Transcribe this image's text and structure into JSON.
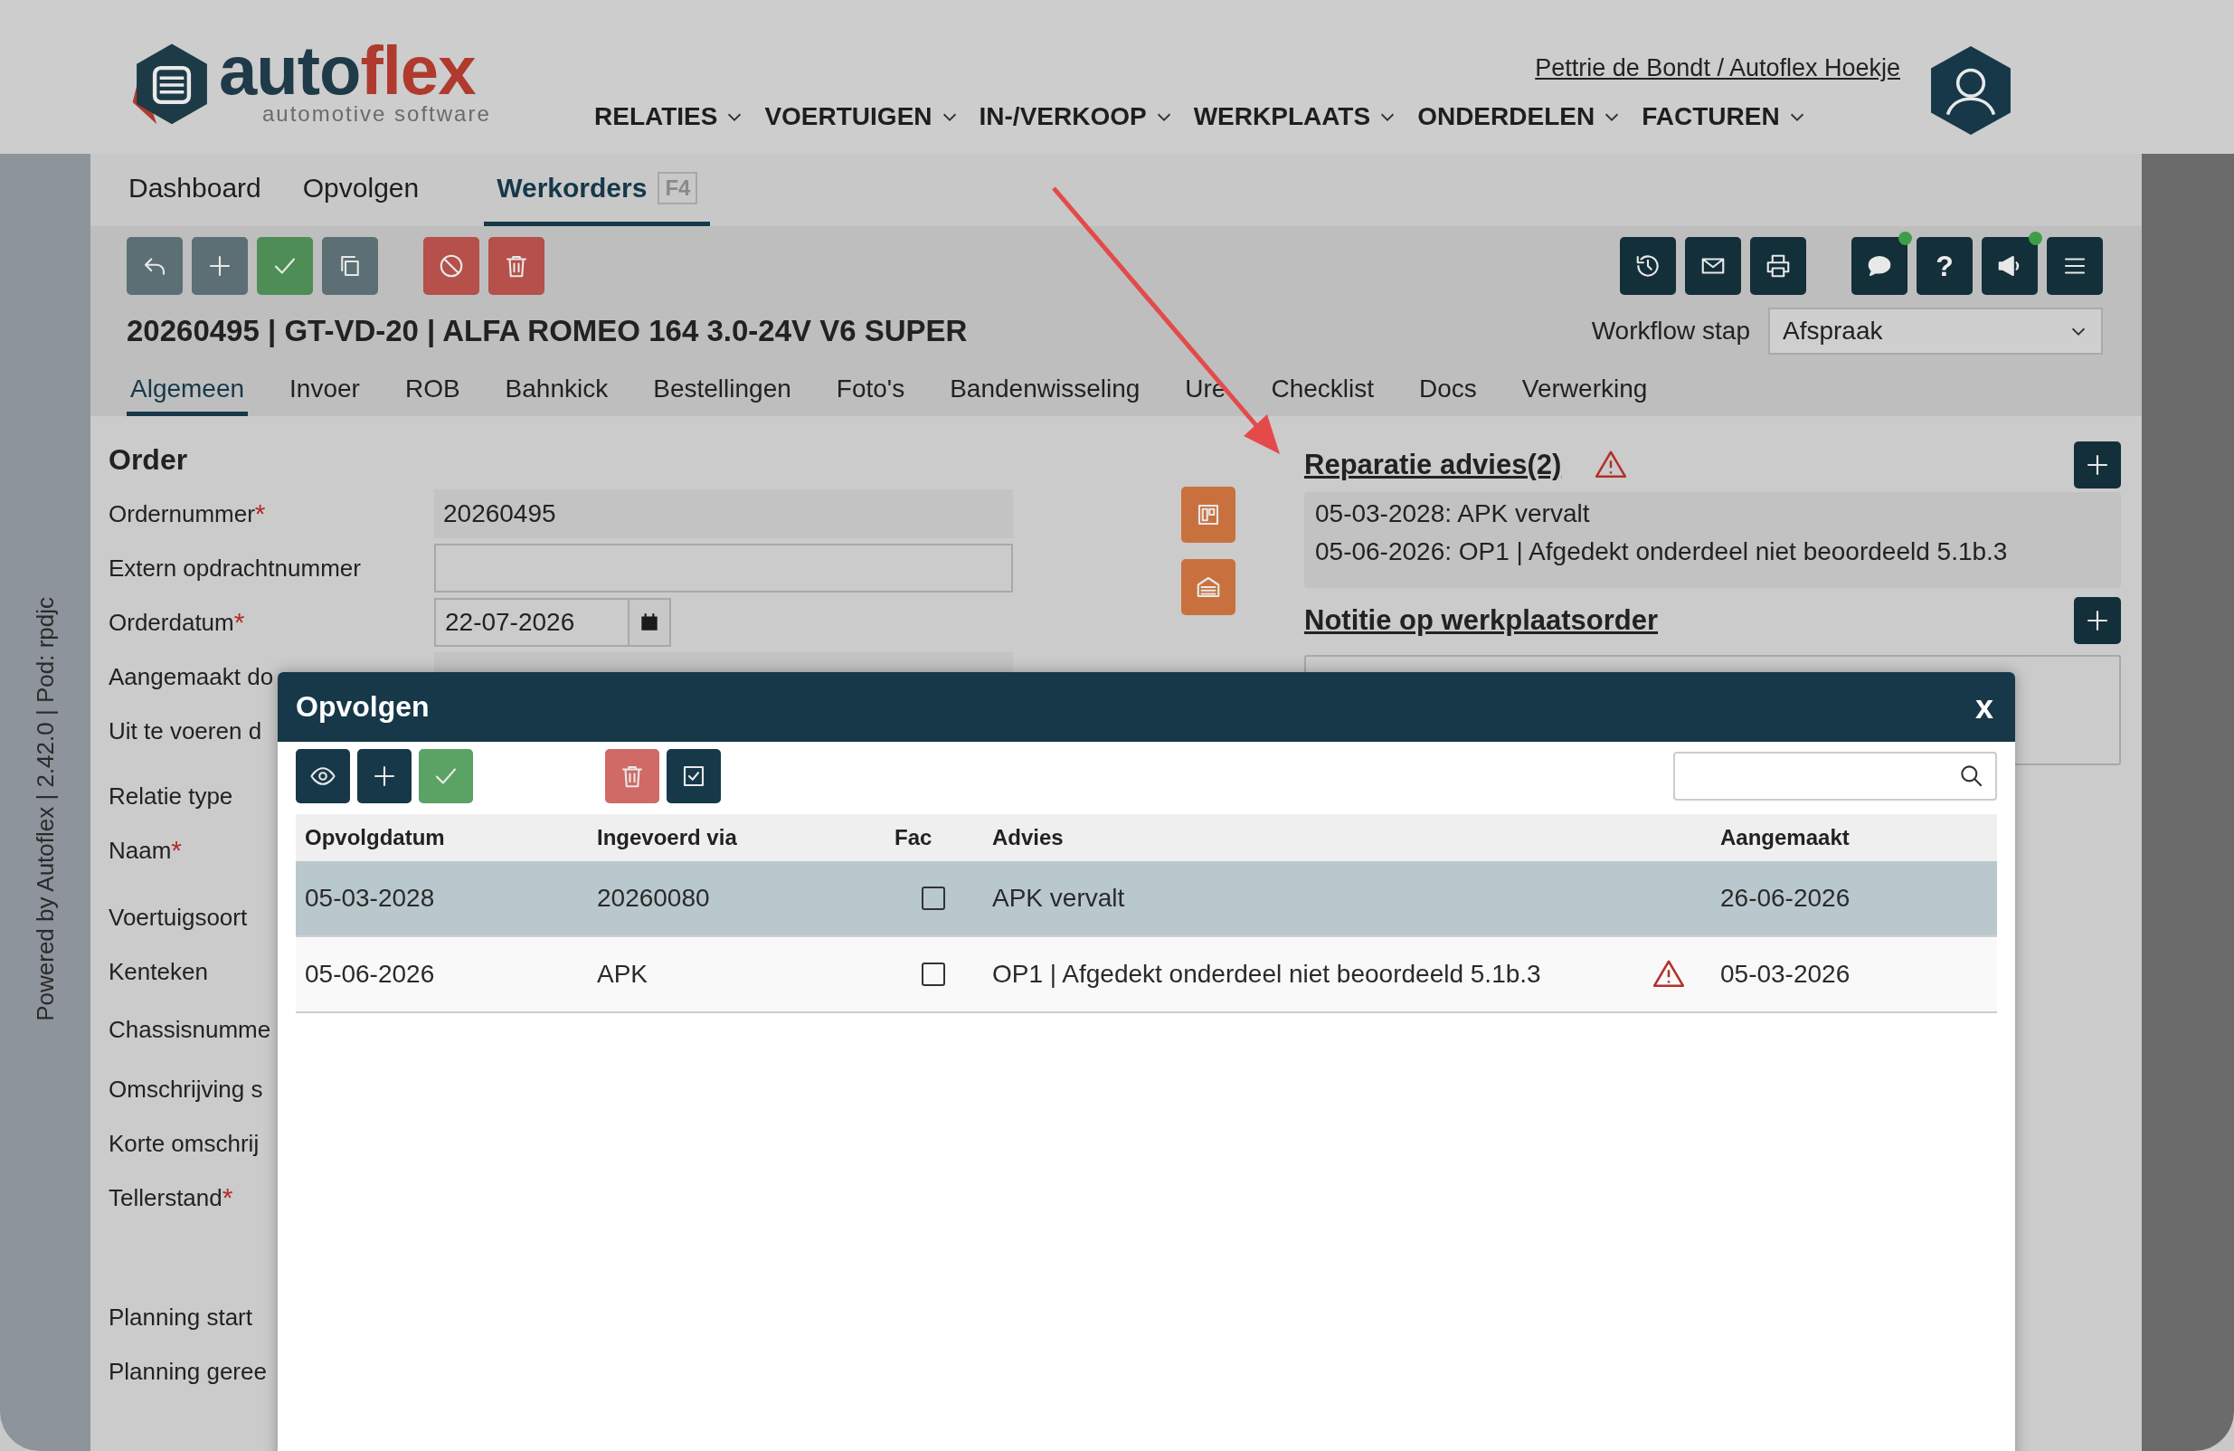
{
  "sidebar_caption": "Powered by Autoflex | 2.42.0 | Pod: rpdjc",
  "logo": {
    "word_dark": "auto",
    "word_accent": "flex",
    "tagline": "automotive software"
  },
  "user_link": "Pettrie de Bondt / Autoflex Hoekje",
  "nav": [
    {
      "label": "RELATIES"
    },
    {
      "label": "VOERTUIGEN"
    },
    {
      "label": "IN-/VERKOOP"
    },
    {
      "label": "WERKPLAATS"
    },
    {
      "label": "ONDERDELEN"
    },
    {
      "label": "FACTUREN"
    }
  ],
  "tabs": [
    {
      "label": "Dashboard",
      "selected": false
    },
    {
      "label": "Opvolgen",
      "selected": false
    },
    {
      "label": "Werkorders",
      "shortcut": "F4",
      "selected": true
    }
  ],
  "toolbar_left": [
    [
      {
        "kind": "undo"
      },
      {
        "kind": "plus"
      },
      {
        "kind": "check"
      },
      {
        "kind": "copy"
      }
    ],
    [
      {
        "kind": "ban"
      },
      {
        "kind": "trash"
      }
    ]
  ],
  "toolbar_right": [
    [
      {
        "kind": "history",
        "notify": false
      },
      {
        "kind": "mail",
        "notify": false
      },
      {
        "kind": "print",
        "notify": false
      }
    ],
    [
      {
        "kind": "chat",
        "notify": true
      },
      {
        "kind": "help",
        "label": "?",
        "notify": false
      },
      {
        "kind": "megaphone",
        "notify": true
      },
      {
        "kind": "menu",
        "notify": false
      }
    ]
  ],
  "title": "20260495 | GT-VD-20 | ALFA ROMEO 164 3.0-24V V6 SUPER",
  "workflow": {
    "label": "Workflow stap",
    "value": "Afspraak"
  },
  "subtabs": [
    {
      "label": "Algemeen",
      "selected": true
    },
    {
      "label": "Invoer",
      "selected": false
    },
    {
      "label": "ROB",
      "selected": false
    },
    {
      "label": "Bahnkick",
      "selected": false
    },
    {
      "label": "Bestellingen",
      "selected": false
    },
    {
      "label": "Foto's",
      "selected": false
    },
    {
      "label": "Bandenwisseling",
      "selected": false
    },
    {
      "label": "Ure",
      "selected": false
    },
    {
      "label": "Checklist",
      "selected": false
    },
    {
      "label": "Docs",
      "selected": false
    },
    {
      "label": "Verwerking",
      "selected": false
    }
  ],
  "order": {
    "heading": "Order",
    "fields": [
      {
        "label": "Ordernummer",
        "required_mark": "*",
        "kind": "readonly",
        "value": "20260495"
      },
      {
        "label": "Extern opdrachtnummer",
        "kind": "input"
      },
      {
        "label": "Orderdatum",
        "required_mark": "*",
        "kind": "date",
        "value": "22-07-2026"
      },
      {
        "label": "Aangemaakt do",
        "kind": "readonly"
      },
      {
        "label": "Uit te voeren d",
        "kind": "none"
      },
      {
        "label": "Relatie type",
        "kind": "none"
      },
      {
        "label": "Naam",
        "required_mark": "*",
        "kind": "none"
      },
      {
        "label": "Voertuigsoort",
        "kind": "none"
      },
      {
        "label": "Kenteken",
        "kind": "none"
      },
      {
        "label": "Chassisnumme",
        "kind": "none"
      },
      {
        "label": "Omschrijving s",
        "kind": "none"
      },
      {
        "label": "Korte omschrij",
        "kind": "none"
      },
      {
        "label": "Tellerstand",
        "required_mark": "*",
        "kind": "none"
      },
      {
        "label": "Planning start",
        "kind": "none"
      },
      {
        "label": "Planning geree",
        "kind": "none"
      }
    ]
  },
  "side_buttons": [
    {
      "kind": "board"
    },
    {
      "kind": "garage"
    }
  ],
  "repair_advice": {
    "title": "Reparatie advies(2)",
    "warning": true,
    "lines": [
      "05-03-2028: APK vervalt",
      "05-06-2026: OP1 | Afgedekt onderdeel niet beoordeeld 5.1b.3"
    ]
  },
  "note": {
    "title": "Notitie op werkplaatsorder"
  },
  "modal": {
    "title": "Opvolgen",
    "close": "x",
    "toolbar": [
      [
        {
          "kind": "eye"
        },
        {
          "kind": "plus"
        },
        {
          "kind": "check"
        }
      ],
      [
        {
          "kind": "trash"
        },
        {
          "kind": "checkbox"
        }
      ]
    ],
    "columns": [
      "Opvolgdatum",
      "Ingevoerd via",
      "Fac",
      "Advies",
      "Aangemaakt"
    ],
    "rows": [
      {
        "date": "05-03-2028",
        "via": "20260080",
        "fac": false,
        "advice": "APK vervalt",
        "warning": false,
        "created": "26-06-2026",
        "selected": true
      },
      {
        "date": "05-06-2026",
        "via": "APK",
        "fac": false,
        "advice": "OP1 | Afgedekt onderdeel niet beoordeeld 5.1b.3",
        "warning": true,
        "created": "05-03-2026",
        "selected": false
      }
    ]
  }
}
